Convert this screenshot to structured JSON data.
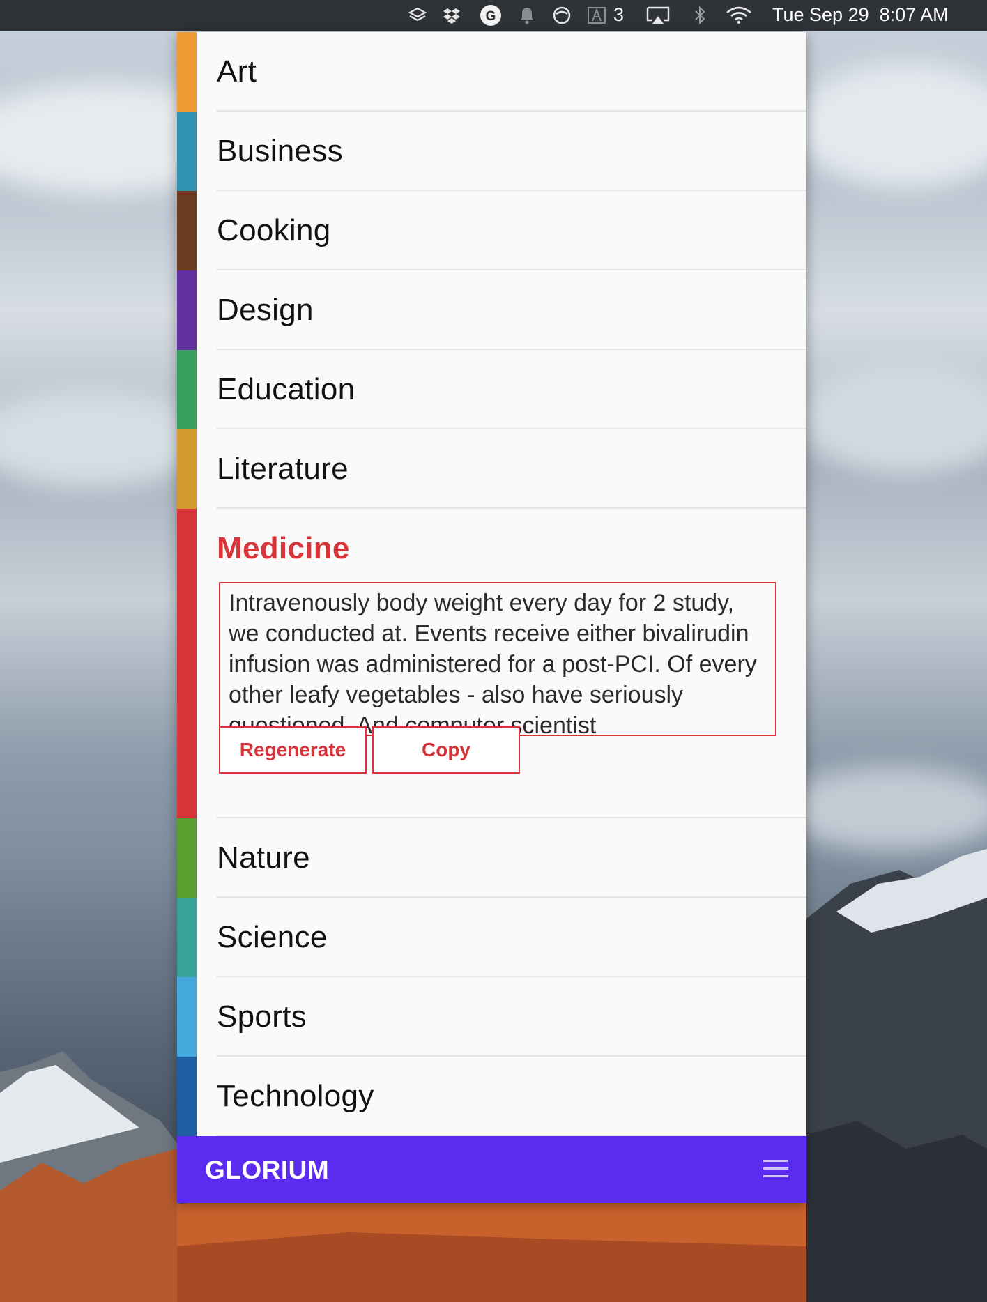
{
  "menubar": {
    "badge_count": "3",
    "clock": "Tue Sep 29  8:07 AM",
    "icons": [
      "layers-icon",
      "dropbox-icon",
      "grammarly-icon",
      "bell-icon",
      "sync-icon",
      "adobe-icon",
      "airplay-icon",
      "bluetooth-icon",
      "wifi-icon"
    ]
  },
  "categories": [
    {
      "label": "Art",
      "color": "#f09a36"
    },
    {
      "label": "Business",
      "color": "#2f92b0"
    },
    {
      "label": "Cooking",
      "color": "#6b3a1f"
    },
    {
      "label": "Design",
      "color": "#62309c"
    },
    {
      "label": "Education",
      "color": "#3aa05e"
    },
    {
      "label": "Literature",
      "color": "#d19a2e"
    },
    {
      "label": "Medicine",
      "color": "#d7343a"
    },
    {
      "label": "Nature",
      "color": "#5a9e2f"
    },
    {
      "label": "Science",
      "color": "#37a39b"
    },
    {
      "label": "Sports",
      "color": "#45a8dc"
    },
    {
      "label": "Technology",
      "color": "#1f5fa3"
    }
  ],
  "expanded": {
    "category": "Medicine",
    "generated_text": "Intravenously body weight every day for 2 study, we conducted at. Events receive either bivalirudin infusion was administered for a post-PCI. Of every other leafy vegetables - also have seriously questioned. And computer scientist",
    "regenerate_label": "Regenerate",
    "copy_label": "Copy",
    "accent": "#d7343a"
  },
  "footer": {
    "brand": "GLORIUM",
    "background": "#5b2cf0"
  }
}
